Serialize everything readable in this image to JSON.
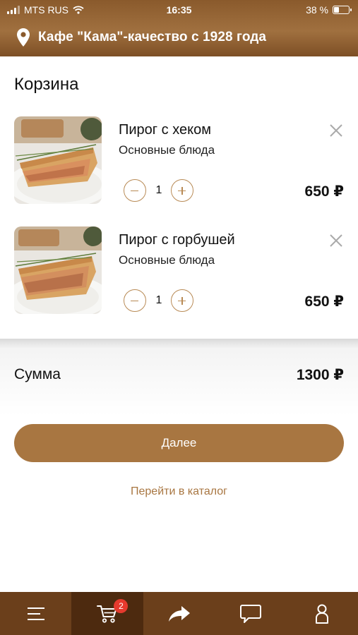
{
  "status_bar": {
    "carrier": "MTS RUS",
    "time": "16:35",
    "battery_text": "38 %",
    "battery_level": 0.38
  },
  "header": {
    "title": "Кафе \"Кама\"-качество с 1928 года"
  },
  "cart": {
    "title": "Корзина",
    "items": [
      {
        "name": "Пирог с хеком",
        "category": "Основные блюда",
        "quantity": "1",
        "price": "650 ₽"
      },
      {
        "name": "Пирог с горбушей",
        "category": "Основные блюда",
        "quantity": "1",
        "price": "650 ₽"
      }
    ]
  },
  "summary": {
    "label": "Сумма",
    "total": "1300 ₽"
  },
  "actions": {
    "next_label": "Далее",
    "catalog_link": "Перейти в каталог"
  },
  "tabbar": {
    "tabs": [
      {
        "icon": "menu-icon"
      },
      {
        "icon": "cart-icon",
        "badge": "2",
        "active": true
      },
      {
        "icon": "share-icon"
      },
      {
        "icon": "chat-icon"
      },
      {
        "icon": "profile-icon"
      }
    ]
  },
  "colors": {
    "brand": "#a87641",
    "header": "#8a5a2c",
    "tabbar": "#6b3f1b",
    "badge": "#e63a2e"
  }
}
